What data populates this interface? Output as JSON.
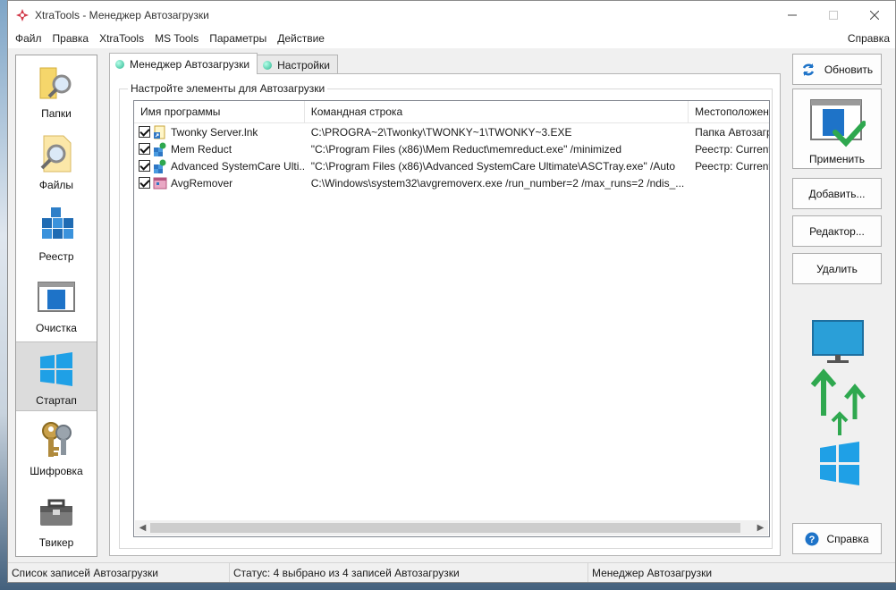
{
  "window": {
    "title": "XtraTools - Менеджер Автозагрузки"
  },
  "menubar": {
    "items": [
      "Файл",
      "Правка",
      "XtraTools",
      "MS Tools",
      "Параметры",
      "Действие"
    ],
    "help": "Справка"
  },
  "sidebar": {
    "items": [
      {
        "label": "Папки",
        "icon": "folder-search-icon"
      },
      {
        "label": "Файлы",
        "icon": "file-search-icon"
      },
      {
        "label": "Реестр",
        "icon": "registry-cubes-icon"
      },
      {
        "label": "Очистка",
        "icon": "cleanup-window-icon"
      },
      {
        "label": "Стартап",
        "icon": "windows-logo-icon",
        "active": true
      },
      {
        "label": "Шифровка",
        "icon": "key-icon"
      },
      {
        "label": "Твикер",
        "icon": "toolbox-icon"
      }
    ]
  },
  "tabs": [
    {
      "label": "Менеджер Автозагрузки",
      "active": true
    },
    {
      "label": "Настройки",
      "active": false
    }
  ],
  "group": {
    "label": "Настройте элементы для Автозагрузки"
  },
  "list": {
    "columns": [
      "Имя программы",
      "Командная строка",
      "Местоположение"
    ],
    "rows": [
      {
        "checked": true,
        "name": "Twonky Server.lnk",
        "command": "C:\\PROGRA~2\\Twonky\\TWONKY~1\\TWONKY~3.EXE",
        "location": "Папка Автозагрузки"
      },
      {
        "checked": true,
        "name": "Mem Reduct",
        "command": "\"C:\\Program Files (x86)\\Mem Reduct\\memreduct.exe\" /minimized",
        "location": "Реестр: Current"
      },
      {
        "checked": true,
        "name": "Advanced SystemCare Ulti...",
        "command": "\"C:\\Program Files (x86)\\Advanced SystemCare Ultimate\\ASCTray.exe\" /Auto",
        "location": "Реестр: Current"
      },
      {
        "checked": true,
        "name": "AvgRemover",
        "command": "C:\\Windows\\system32\\avgremoverx.exe /run_number=2 /max_runs=2 /ndis_...",
        "location": ""
      }
    ]
  },
  "buttons": {
    "refresh": "Обновить",
    "apply": "Применить",
    "add": "Добавить...",
    "editor": "Редактор...",
    "delete": "Удалить",
    "help": "Справка"
  },
  "statusbar": {
    "left": "Список записей Автозагрузки",
    "middle": "Статус: 4 выбрано из 4 записей Автозагрузки",
    "right": "Менеджер Автозагрузки"
  },
  "colors": {
    "accent_green": "#2fa84f",
    "accent_blue": "#1e73c8",
    "windows_blue": "#1fa0e6"
  }
}
